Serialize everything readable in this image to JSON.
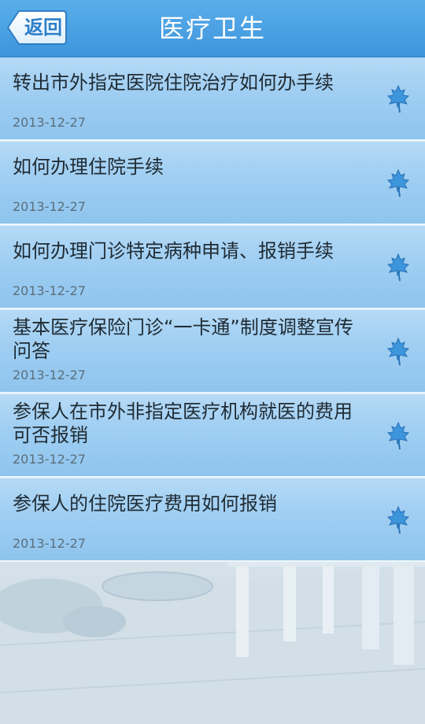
{
  "header": {
    "back_label": "返回",
    "title": "医疗卫生"
  },
  "list": [
    {
      "title": "转出市外指定医院住院治疗如何办手续",
      "date": "2013-12-27"
    },
    {
      "title": "如何办理住院手续",
      "date": "2013-12-27"
    },
    {
      "title": "如何办理门诊特定病种申请、报销手续",
      "date": "2013-12-27"
    },
    {
      "title": "基本医疗保险门诊“一卡通”制度调整宣传问答",
      "date": "2013-12-27"
    },
    {
      "title": "参保人在市外非指定医疗机构就医的费用可否报销",
      "date": "2013-12-27"
    },
    {
      "title": "参保人的住院医疗费用如何报销",
      "date": "2013-12-27"
    }
  ],
  "colors": {
    "header": "#4aa3e4",
    "list_item": "#a3d0f3",
    "icon": "#3d95dc"
  },
  "icons": {
    "item_icon": "maple-leaf-icon",
    "back_icon": "back-arrow-icon"
  }
}
